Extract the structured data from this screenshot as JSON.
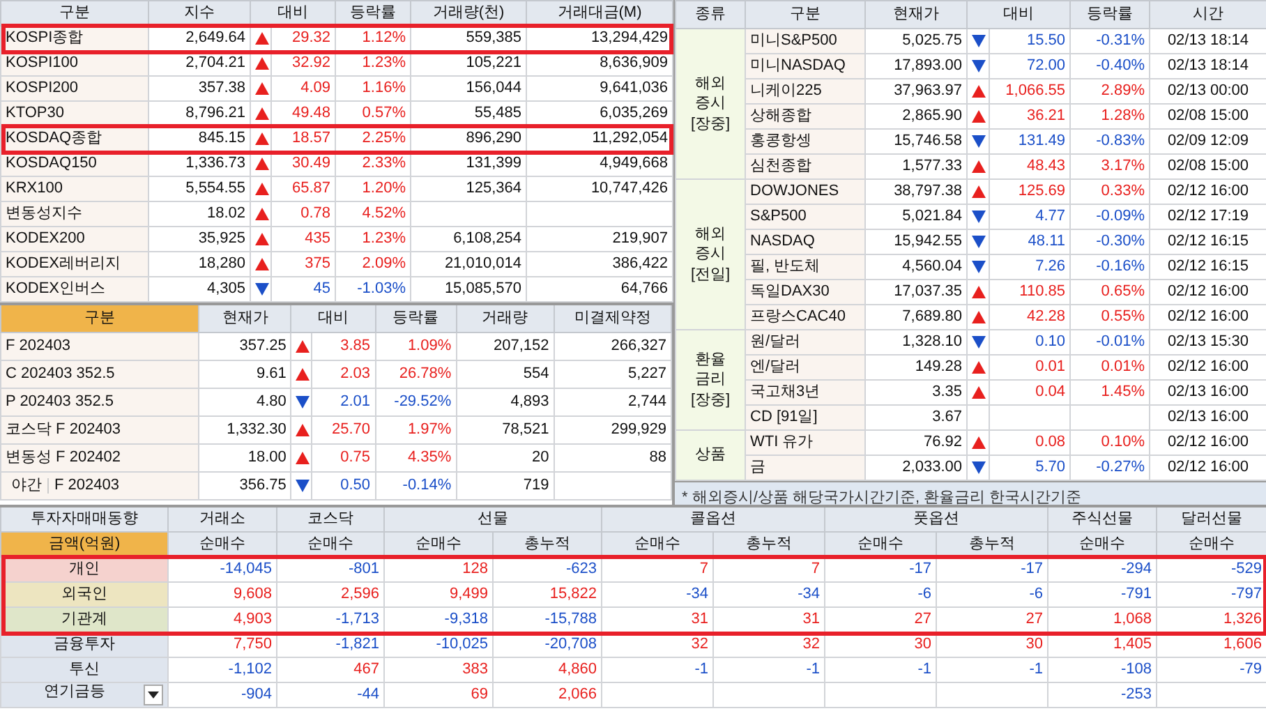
{
  "index_table": {
    "columns": [
      "구분",
      "지수",
      "대비",
      "등락률",
      "거래량(천)",
      "거래대금(M)"
    ],
    "rows": [
      {
        "name": "KOSPI종합",
        "value": "2,649.64",
        "rising": true,
        "change": "29.32",
        "rate": "1.12%",
        "volume": "559,385",
        "amount": "13,294,429",
        "highlighted": true
      },
      {
        "name": "KOSPI100",
        "value": "2,704.21",
        "rising": true,
        "change": "32.92",
        "rate": "1.23%",
        "volume": "105,221",
        "amount": "8,636,909",
        "highlighted": false
      },
      {
        "name": "KOSPI200",
        "value": "357.38",
        "rising": true,
        "change": "4.09",
        "rate": "1.16%",
        "volume": "156,044",
        "amount": "9,641,036",
        "highlighted": false
      },
      {
        "name": "KTOP30",
        "value": "8,796.21",
        "rising": true,
        "change": "49.48",
        "rate": "0.57%",
        "volume": "55,485",
        "amount": "6,035,269",
        "highlighted": false
      },
      {
        "name": "KOSDAQ종합",
        "value": "845.15",
        "rising": true,
        "change": "18.57",
        "rate": "2.25%",
        "volume": "896,290",
        "amount": "11,292,054",
        "highlighted": true
      },
      {
        "name": "KOSDAQ150",
        "value": "1,336.73",
        "rising": true,
        "change": "30.49",
        "rate": "2.33%",
        "volume": "131,399",
        "amount": "4,949,668",
        "highlighted": false
      },
      {
        "name": "KRX100",
        "value": "5,554.55",
        "rising": true,
        "change": "65.87",
        "rate": "1.20%",
        "volume": "125,364",
        "amount": "10,747,426",
        "highlighted": false
      },
      {
        "name": "변동성지수",
        "value": "18.02",
        "rising": true,
        "change": "0.78",
        "rate": "4.52%",
        "highlighted": false
      },
      {
        "name": "KODEX200",
        "value": "35,925",
        "rising": true,
        "change": "435",
        "rate": "1.23%",
        "volume": "6,108,254",
        "amount": "219,907",
        "highlighted": false
      },
      {
        "name": "KODEX레버리지",
        "value": "18,280",
        "rising": true,
        "change": "375",
        "rate": "2.09%",
        "volume": "21,010,014",
        "amount": "386,422",
        "highlighted": false
      },
      {
        "name": "KODEX인버스",
        "value": "4,305",
        "rising": false,
        "change": "45",
        "rate": "-1.03%",
        "volume": "15,085,570",
        "amount": "64,766",
        "highlighted": false
      }
    ]
  },
  "futures_table": {
    "columns": [
      "구분",
      "현재가",
      "대비",
      "등락률",
      "거래량",
      "미결제약정"
    ],
    "rows": [
      {
        "kind": "normal",
        "name": "F 202403",
        "price": "357.25",
        "rising": true,
        "change": "3.85",
        "rate": "1.09%",
        "volume": "207,152",
        "open_interest": "266,327"
      },
      {
        "kind": "normal",
        "name": "C 202403 352.5",
        "price": "9.61",
        "rising": true,
        "change": "2.03",
        "rate": "26.78%",
        "volume": "554",
        "open_interest": "5,227"
      },
      {
        "kind": "normal",
        "name": "P 202403 352.5",
        "price": "4.80",
        "rising": false,
        "change": "2.01",
        "rate": "-29.52%",
        "volume": "4,893",
        "open_interest": "2,744"
      },
      {
        "kind": "normal",
        "name": "코스닥 F 202403",
        "price": "1,332.30",
        "rising": true,
        "change": "25.70",
        "rate": "1.97%",
        "volume": "78,521",
        "open_interest": "299,929"
      },
      {
        "kind": "normal",
        "name": "변동성 F 202402",
        "price": "18.00",
        "rising": true,
        "change": "0.75",
        "rate": "4.35%",
        "volume": "20",
        "open_interest": "88"
      },
      {
        "kind": "night",
        "session": "야간",
        "name": "F 202403",
        "price": "356.75",
        "rising": false,
        "change": "0.50",
        "rate": "-0.14%",
        "volume": "719"
      }
    ]
  },
  "global_table": {
    "columns": [
      "종류",
      "구분",
      "현재가",
      "대비",
      "등락률",
      "시간"
    ],
    "groups": [
      {
        "label": "해외\n증시\n[장중]",
        "rows": [
          {
            "name": "미니S&P500",
            "price": "5,025.75",
            "rising": false,
            "change": "15.50",
            "rate": "-0.31%",
            "time": "02/13 18:14"
          },
          {
            "name": "미니NASDAQ",
            "price": "17,893.00",
            "rising": false,
            "change": "72.00",
            "rate": "-0.40%",
            "time": "02/13 18:14"
          },
          {
            "name": "니케이225",
            "price": "37,963.97",
            "rising": true,
            "change": "1,066.55",
            "rate": "2.89%",
            "time": "02/13 00:00"
          },
          {
            "name": "상해종합",
            "price": "2,865.90",
            "rising": true,
            "change": "36.21",
            "rate": "1.28%",
            "time": "02/08 15:00"
          },
          {
            "name": "홍콩항셍",
            "price": "15,746.58",
            "rising": false,
            "change": "131.49",
            "rate": "-0.83%",
            "time": "02/09 12:09"
          },
          {
            "name": "심천종합",
            "price": "1,577.33",
            "rising": true,
            "change": "48.43",
            "rate": "3.17%",
            "time": "02/08 15:00"
          }
        ]
      },
      {
        "label": "해외\n증시\n[전일]",
        "rows": [
          {
            "name": "DOWJONES",
            "price": "38,797.38",
            "rising": true,
            "change": "125.69",
            "rate": "0.33%",
            "time": "02/12 16:00"
          },
          {
            "name": "S&P500",
            "price": "5,021.84",
            "rising": false,
            "change": "4.77",
            "rate": "-0.09%",
            "time": "02/12 17:19"
          },
          {
            "name": "NASDAQ",
            "price": "15,942.55",
            "rising": false,
            "change": "48.11",
            "rate": "-0.30%",
            "time": "02/12 16:15"
          },
          {
            "name": "필, 반도체",
            "price": "4,560.04",
            "rising": false,
            "change": "7.26",
            "rate": "-0.16%",
            "time": "02/12 16:15"
          },
          {
            "name": "독일DAX30",
            "price": "17,037.35",
            "rising": true,
            "change": "110.85",
            "rate": "0.65%",
            "time": "02/12 16:00"
          },
          {
            "name": "프랑스CAC40",
            "price": "7,689.80",
            "rising": true,
            "change": "42.28",
            "rate": "0.55%",
            "time": "02/12 16:00"
          }
        ]
      },
      {
        "label": "환율\n금리\n[장중]",
        "rows": [
          {
            "name": "원/달러",
            "price": "1,328.10",
            "rising": false,
            "change": "0.10",
            "rate": "-0.01%",
            "time": "02/13 15:30"
          },
          {
            "name": "엔/달러",
            "price": "149.28",
            "rising": true,
            "change": "0.01",
            "rate": "0.01%",
            "time": "02/12 16:00"
          },
          {
            "name": "국고채3년",
            "price": "3.35",
            "rising": true,
            "change": "0.04",
            "rate": "1.45%",
            "time": "02/13 16:00"
          },
          {
            "name": "CD [91일]",
            "price": "3.67",
            "time": "02/13 16:00"
          }
        ]
      },
      {
        "label": "상품",
        "rows": [
          {
            "name": "WTI 유가",
            "price": "76.92",
            "rising": true,
            "change": "0.08",
            "rate": "0.10%",
            "time": "02/12 16:00"
          },
          {
            "name": "금",
            "price": "2,033.00",
            "rising": false,
            "change": "5.70",
            "rate": "-0.27%",
            "time": "02/12 16:00"
          }
        ]
      }
    ],
    "footnote": "* 해외증시/상품 해당국가시간기준, 환율금리 한국시간기준"
  },
  "investor_table": {
    "title": "투자자매매동향",
    "unit": "금액(억원)",
    "groups": [
      {
        "label": "거래소",
        "subs": [
          "순매수"
        ]
      },
      {
        "label": "코스닥",
        "subs": [
          "순매수"
        ]
      },
      {
        "label": "선물",
        "subs": [
          "순매수",
          "총누적"
        ]
      },
      {
        "label": "콜옵션",
        "subs": [
          "순매수",
          "총누적"
        ]
      },
      {
        "label": "풋옵션",
        "subs": [
          "순매수",
          "총누적"
        ]
      },
      {
        "label": "주식선물",
        "subs": [
          "순매수"
        ]
      },
      {
        "label": "달러선물",
        "subs": [
          "순매수"
        ]
      }
    ],
    "rows": [
      {
        "label": "개인",
        "color": "#f5d2ce",
        "highlighted": true,
        "dropdown": false,
        "cells": [
          {
            "text": "-14,045",
            "negative": true
          },
          {
            "text": "-801",
            "negative": true
          },
          {
            "text": "128",
            "negative": false
          },
          {
            "text": "-623",
            "negative": true
          },
          {
            "text": "7",
            "negative": false
          },
          {
            "text": "7",
            "negative": false
          },
          {
            "text": "-17",
            "negative": true
          },
          {
            "text": "-17",
            "negative": true
          },
          {
            "text": "-294",
            "negative": true
          },
          {
            "text": "-529",
            "negative": true
          }
        ]
      },
      {
        "label": "외국인",
        "color": "#ede5c0",
        "highlighted": true,
        "dropdown": false,
        "cells": [
          {
            "text": "9,608",
            "negative": false
          },
          {
            "text": "2,596",
            "negative": false
          },
          {
            "text": "9,499",
            "negative": false
          },
          {
            "text": "15,822",
            "negative": false
          },
          {
            "text": "-34",
            "negative": true
          },
          {
            "text": "-34",
            "negative": true
          },
          {
            "text": "-6",
            "negative": true
          },
          {
            "text": "-6",
            "negative": true
          },
          {
            "text": "-791",
            "negative": true
          },
          {
            "text": "-797",
            "negative": true
          }
        ]
      },
      {
        "label": "기관계",
        "color": "#dfe6c9",
        "highlighted": true,
        "dropdown": false,
        "cells": [
          {
            "text": "4,903",
            "negative": false
          },
          {
            "text": "-1,713",
            "negative": true
          },
          {
            "text": "-9,318",
            "negative": true
          },
          {
            "text": "-15,788",
            "negative": true
          },
          {
            "text": "31",
            "negative": false
          },
          {
            "text": "31",
            "negative": false
          },
          {
            "text": "27",
            "negative": false
          },
          {
            "text": "27",
            "negative": false
          },
          {
            "text": "1,068",
            "negative": false
          },
          {
            "text": "1,326",
            "negative": false
          }
        ]
      },
      {
        "label": "금융투자",
        "color": "#dfe5ee",
        "highlighted": false,
        "dropdown": false,
        "cells": [
          {
            "text": "7,750",
            "negative": false
          },
          {
            "text": "-1,821",
            "negative": true
          },
          {
            "text": "-10,025",
            "negative": true
          },
          {
            "text": "-20,708",
            "negative": true
          },
          {
            "text": "32",
            "negative": false
          },
          {
            "text": "32",
            "negative": false
          },
          {
            "text": "30",
            "negative": false
          },
          {
            "text": "30",
            "negative": false
          },
          {
            "text": "1,405",
            "negative": false
          },
          {
            "text": "1,606",
            "negative": false
          }
        ]
      },
      {
        "label": "투신",
        "color": "#dfe5ee",
        "highlighted": false,
        "dropdown": false,
        "cells": [
          {
            "text": "-1,102",
            "negative": true
          },
          {
            "text": "467",
            "negative": false
          },
          {
            "text": "383",
            "negative": false
          },
          {
            "text": "4,860",
            "negative": false
          },
          {
            "text": "-1",
            "negative": true
          },
          {
            "text": "-1",
            "negative": true
          },
          {
            "text": "-1",
            "negative": true
          },
          {
            "text": "-1",
            "negative": true
          },
          {
            "text": "-108",
            "negative": true
          },
          {
            "text": "-79",
            "negative": true
          }
        ]
      },
      {
        "label": "연기금등",
        "color": "#dfe5ee",
        "highlighted": false,
        "dropdown": true,
        "cells": [
          {
            "text": "-904",
            "negative": true
          },
          {
            "text": "-44",
            "negative": true
          },
          {
            "text": "69",
            "negative": false
          },
          {
            "text": "2,066",
            "negative": false
          },
          null,
          null,
          null,
          null,
          {
            "text": "-253",
            "negative": true
          },
          null
        ]
      }
    ]
  }
}
